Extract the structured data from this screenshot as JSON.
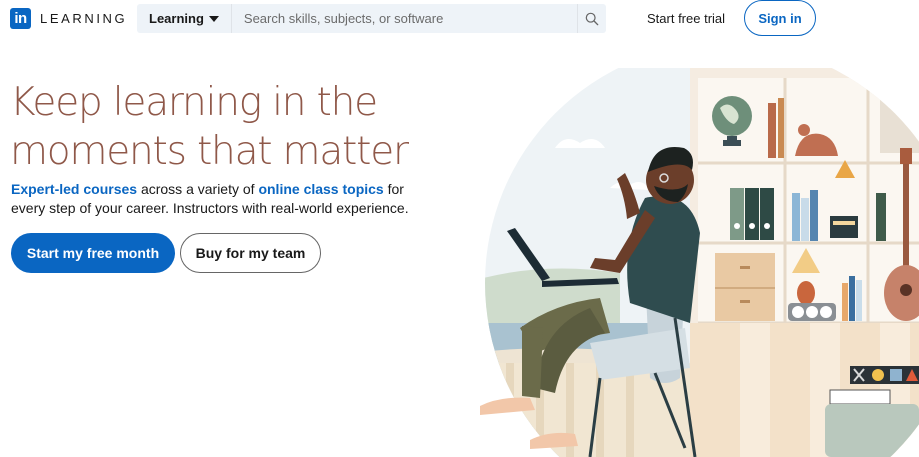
{
  "brand": {
    "logo_mark": "in",
    "logo_text": "LEARNING"
  },
  "search": {
    "category_label": "Learning",
    "placeholder": "Search skills, subjects, or software",
    "button_icon": "search-icon"
  },
  "nav": {
    "start_trial": "Start free trial",
    "sign_in": "Sign in"
  },
  "hero": {
    "headline_line1": "Keep learning in the",
    "headline_line2": "moments that matter",
    "sub_link1": "Expert-led courses",
    "sub_text1": " across a variety of ",
    "sub_link2": "online class topics",
    "sub_text2": " for every step of your career. Instructors with real-world experience.",
    "primary_cta": "Start my free month",
    "secondary_cta": "Buy for my team"
  },
  "colors": {
    "brand_blue": "#0a66c2",
    "headline": "#8f5849"
  }
}
